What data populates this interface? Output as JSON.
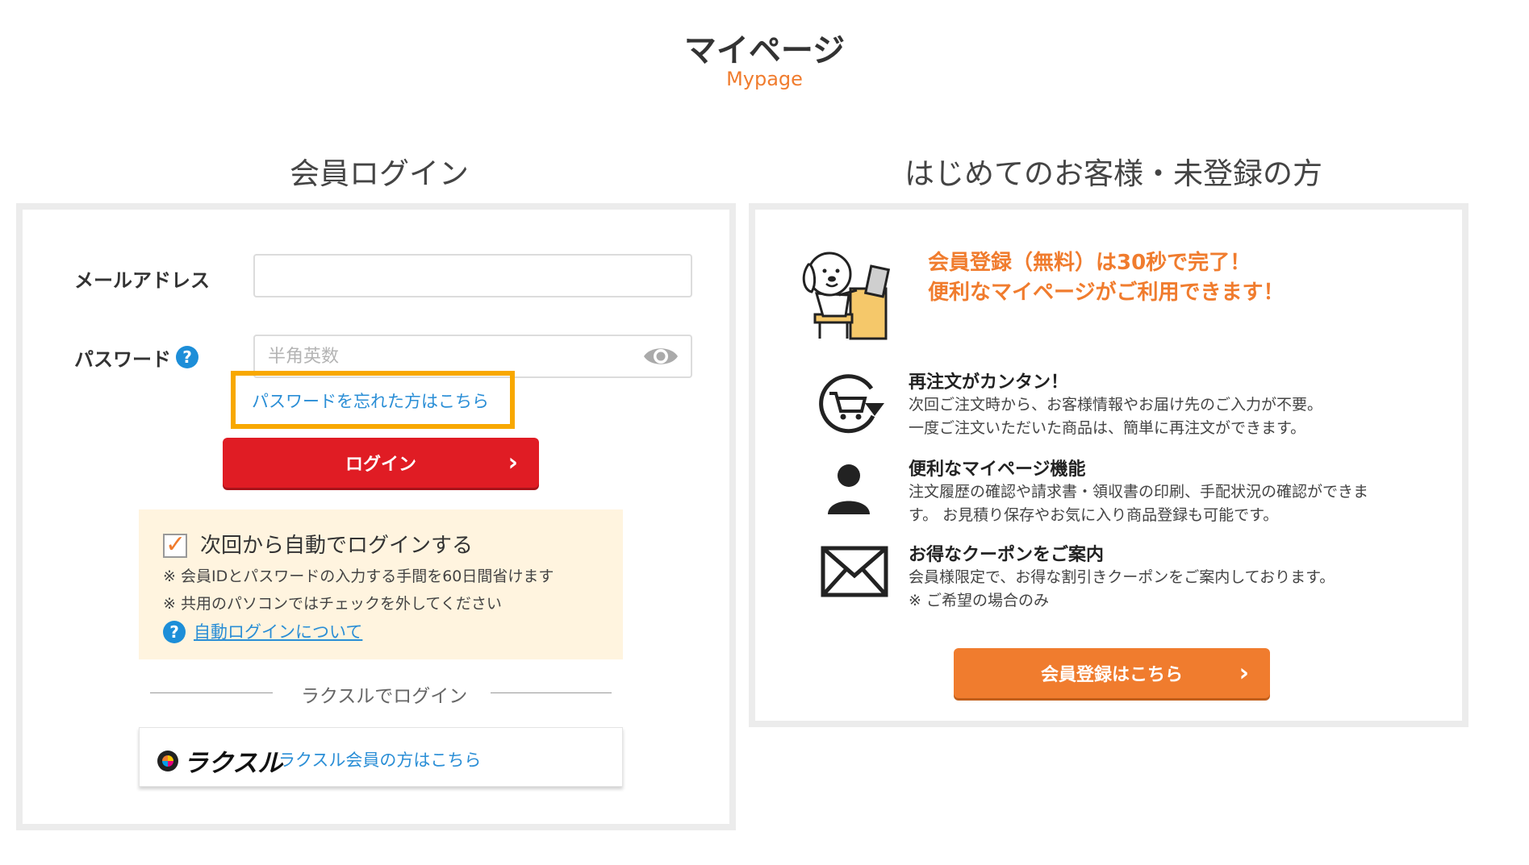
{
  "header": {
    "title": "マイページ",
    "subtitle": "Mypage"
  },
  "login": {
    "heading": "会員ログイン",
    "email_label": "メールアドレス",
    "email_value": "",
    "password_label": "パスワード",
    "password_placeholder": "半角英数",
    "help_icon_glyph": "?",
    "forgot_link": "パスワードを忘れた方はこちら",
    "submit_label": "ログイン",
    "chevron": "›",
    "auto_login": {
      "label": "次回から自動でログインする",
      "checked": true,
      "note1": "※ 会員IDとパスワードの入力する手間を60日間省けます",
      "note2": "※ 共用のパソコンではチェックを外してください",
      "help_link": "自動ログインについて"
    },
    "divider_text": "ラクスルでログイン",
    "raksul": {
      "logo_text": "ラクスル",
      "link": "ラクスル会員の方はこちら"
    }
  },
  "register": {
    "heading": "はじめてのお客様・未登録の方",
    "promo_line1": "会員登録（無料）は30秒で完了！",
    "promo_line2": "便利なマイページがご利用できます！",
    "features": [
      {
        "icon": "cart-reorder-icon",
        "title": "再注文がカンタン！",
        "desc1": "次回ご注文時から、お客様情報やお届け先のご入力が不要。",
        "desc2": "一度ご注文いただいた商品は、簡単に再注文ができます。"
      },
      {
        "icon": "user-icon",
        "title": "便利なマイページ機能",
        "desc1": "注文履歴の確認や請求書・領収書の印刷、手配状況の確認ができま",
        "desc2": "す。 お見積り保存やお気に入り商品登録も可能です。"
      },
      {
        "icon": "envelope-icon",
        "title": "お得なクーポンをご案内",
        "desc1": "会員様限定で、お得な割引きクーポンをご案内しております。",
        "desc2": "※ ご希望の場合のみ"
      }
    ],
    "button_label": "会員登録はこちら",
    "chevron": "›"
  },
  "colors": {
    "accent_orange": "#f07c2e",
    "login_red": "#e01c24",
    "highlight_yellow": "#f8a800",
    "link_blue": "#2a8ed6",
    "auto_login_bg": "#fff4df"
  }
}
